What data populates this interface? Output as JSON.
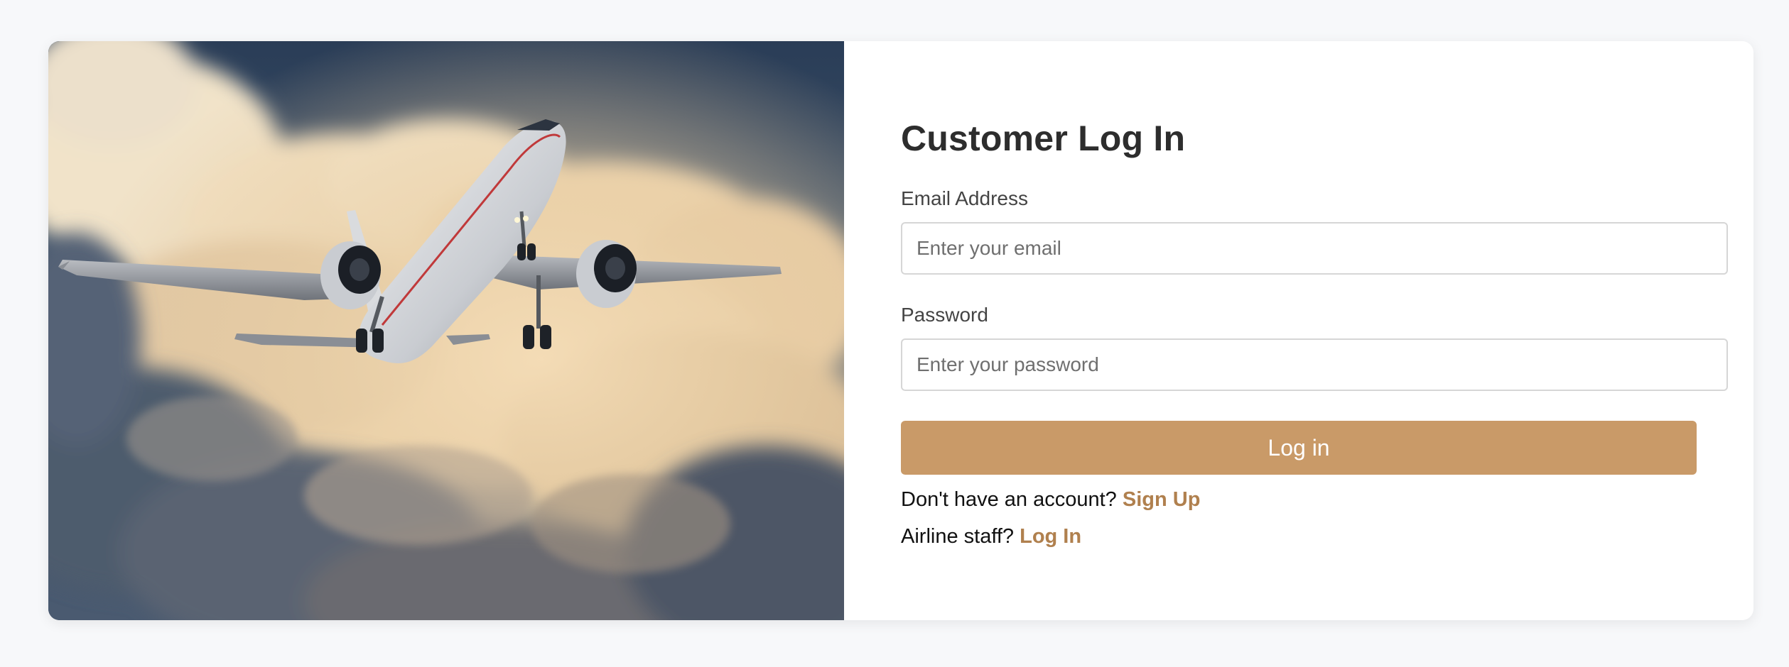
{
  "colors": {
    "accent": "#c99a68",
    "link": "#b0804e",
    "page_background": "#f7f8fa"
  },
  "hero": {
    "image": "airplane taking off through clouds"
  },
  "form": {
    "title": "Customer Log In",
    "email_label": "Email Address",
    "email_placeholder": "Enter your email",
    "email_value": "",
    "password_label": "Password",
    "password_placeholder": "Enter your password",
    "password_value": "",
    "submit_label": "Log in"
  },
  "footer": {
    "signup_prompt": "Don't have an account?",
    "signup_link": "Sign Up",
    "staff_prompt": "Airline staff?",
    "staff_link": "Log In"
  }
}
